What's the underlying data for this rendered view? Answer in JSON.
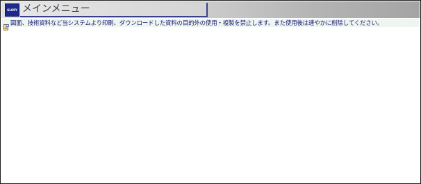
{
  "header": {
    "logo_text": "GLORY",
    "title": "メインメニュー"
  },
  "notice": {
    "icon": "document-icon",
    "text": "図面、技術資料など当システムより印刷、ダウンロードした資料の目的外の使用・複製を禁止します。また使用後は速やかに削除してください。"
  },
  "colors": {
    "logo_bg": "#1d2a8c",
    "title_border": "#3b3f8f",
    "notice_text": "#17166e",
    "notice_bg": "#eef6f2"
  }
}
